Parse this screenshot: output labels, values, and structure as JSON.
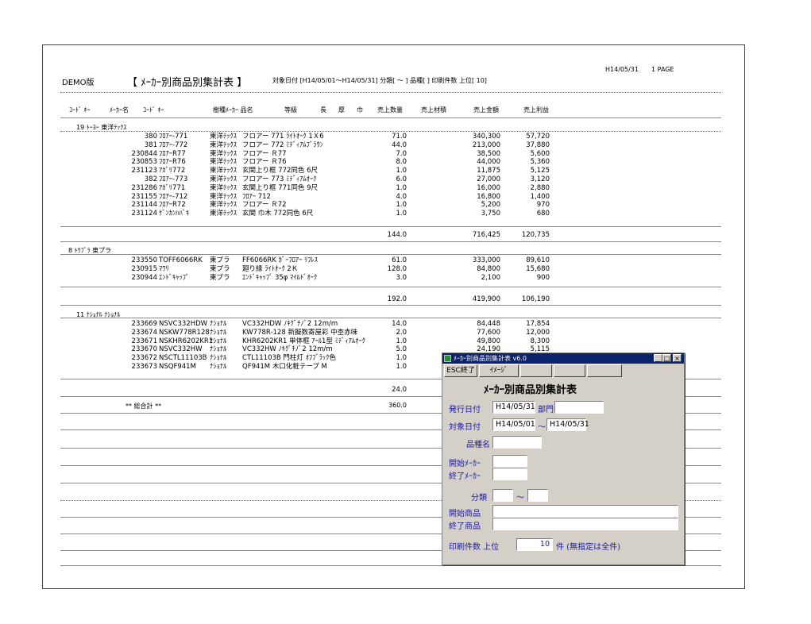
{
  "report": {
    "demo_label": "DEMO版",
    "title": "【 ﾒｰｶｰ別商品別集計表 】",
    "criteria": "対象日付 [H14/05/01～H14/05/31]  分類[   ～   ] 品種[              ]  印刷件数 上位[   10]",
    "print_date": "H14/05/31",
    "page": "1 PAGE"
  },
  "columns": {
    "c1": "ｺｰﾄﾞ ｷｰ",
    "c2": "ﾒｰｶｰ名",
    "c3": "ｺｰﾄﾞ ｷｰ",
    "c4": "樹種ﾒｰｶｰ 品名",
    "c5": "等級",
    "c6": "長",
    "c7": "厚",
    "c8": "巾",
    "c9": "売上数量",
    "c10": "売上材積",
    "c11": "売上金額",
    "c12": "売上利益"
  },
  "groups": [
    {
      "header": "19 ﾄｰﾖｰ   東洋ﾃｯｸｽ",
      "items": [
        {
          "code": "380",
          "name": "ﾌﾛｱｰ-771",
          "maker": "東洋ﾃｯｸｽ",
          "desc": "フロアー 771 ﾗｲﾄｵｰｸ 1Ｘ6",
          "qty": "71.0",
          "amount": "340,300",
          "profit": "57,720"
        },
        {
          "code": "381",
          "name": "ﾌﾛｱｰ-772",
          "maker": "東洋ﾃｯｸｽ",
          "desc": "フロアー 772 ﾐﾃﾞｨｱﾑﾌﾞﾗｳﾝ",
          "qty": "44.0",
          "amount": "213,000",
          "profit": "37,880"
        },
        {
          "code": "230844",
          "name": "ﾌﾛｱｰR77",
          "maker": "東洋ﾃｯｸｽ",
          "desc": "フロアー  Ｒ77",
          "qty": "7.0",
          "amount": "38,500",
          "profit": "5,600"
        },
        {
          "code": "230853",
          "name": "ﾌﾛｱｰR76",
          "maker": "東洋ﾃｯｸｽ",
          "desc": "フロアー  Ｒ76",
          "qty": "8.0",
          "amount": "44,000",
          "profit": "5,360"
        },
        {
          "code": "231123",
          "name": "ｱｶﾞﾘ772",
          "maker": "東洋ﾃｯｸｽ",
          "desc": "玄関上り框  772同色  6尺",
          "qty": "1.0",
          "amount": "11,875",
          "profit": "5,125"
        },
        {
          "code": "382",
          "name": "ﾌﾛｱｰ-773",
          "maker": "東洋ﾃｯｸｽ",
          "desc": "フロアー  773 ﾐﾃﾞｨｱﾑｵｰｸ",
          "qty": "6.0",
          "amount": "27,000",
          "profit": "3,120"
        },
        {
          "code": "231286",
          "name": "ｱｶﾞﾘ771",
          "maker": "東洋ﾃｯｸｽ",
          "desc": "玄関上り框  771同色  9尺",
          "qty": "1.0",
          "amount": "16,000",
          "profit": "2,880"
        },
        {
          "code": "231155",
          "name": "ﾌﾛｱｰ-712",
          "maker": "東洋ﾃｯｸｽ",
          "desc": "ﾌﾛｱｰ  712",
          "qty": "4.0",
          "amount": "16,800",
          "profit": "1,400"
        },
        {
          "code": "231144",
          "name": "ﾌﾛｱｰR72",
          "maker": "東洋ﾃｯｸｽ",
          "desc": "フロアー  Ｒ72",
          "qty": "1.0",
          "amount": "5,200",
          "profit": "970"
        },
        {
          "code": "231124",
          "name": "ｹﾞﾝｶﾝﾊﾊﾞｷ",
          "maker": "東洋ﾃｯｸｽ",
          "desc": "玄関 巾木 772同色 6尺",
          "qty": "1.0",
          "amount": "3,750",
          "profit": "680"
        }
      ],
      "subtotal": {
        "qty": "144.0",
        "amount": "716,425",
        "profit": "120,735"
      }
    },
    {
      "header": "8 ﾄｳﾌﾟﾗ  東プラ",
      "items": [
        {
          "code": "233550",
          "name": "TOFF6066RK",
          "maker": "東プラ",
          "desc": "FF6066RK ｶﾞｰﾌﾛｱｰ ﾘﾌﾚｽ",
          "qty": "61.0",
          "amount": "333,000",
          "profit": "89,610"
        },
        {
          "code": "230915",
          "name": "ﾏﾜﾘ",
          "maker": "東プラ",
          "desc": "廻り縁  ﾗｲﾄｵｰｸ   2Ｋ",
          "qty": "128.0",
          "amount": "84,800",
          "profit": "15,680"
        },
        {
          "code": "230944",
          "name": "ｴﾝﾄﾞｷｬｯﾌﾟ",
          "maker": "東プラ",
          "desc": "ｴﾝﾄﾞｷｬｯﾌﾟ 35φ ﾏｲﾙﾄﾞｵｰｸ",
          "qty": "3.0",
          "amount": "2,100",
          "profit": "900"
        }
      ],
      "subtotal": {
        "qty": "192.0",
        "amount": "419,900",
        "profit": "106,190"
      }
    },
    {
      "header": "11 ﾅｼｮﾅﾙ  ﾅｼｮﾅﾙ",
      "items": [
        {
          "code": "233669",
          "name": "NSVC332HDW",
          "maker": "ﾅｼｮﾅﾙ",
          "desc": "VC332HDW ﾉｷｸﾞﾁﾉﾞ2  12m/m",
          "qty": "14.0",
          "amount": "84,448",
          "profit": "17,854"
        },
        {
          "code": "233674",
          "name": "NSKW778R128",
          "maker": "ﾅｼｮﾅﾙ",
          "desc": "KW778R-128 新擬数寄屋彩 中杢赤味",
          "qty": "2.0",
          "amount": "77,600",
          "profit": "12,000"
        },
        {
          "code": "233671",
          "name": "NSKHR6202KR1",
          "maker": "ﾅｼｮﾅﾙ",
          "desc": "KHR6202KR1 単体框 ｱｰﾙ1型 ﾐﾃﾞｨｱﾑｵｰｸ",
          "qty": "1.0",
          "amount": "49,800",
          "profit": "8,300"
        },
        {
          "code": "233670",
          "name": "NSVC332HW",
          "maker": "ﾅｼｮﾅﾙ",
          "desc": "VC332HW ﾉｷｸﾞﾁﾉﾞ2  12m/m",
          "qty": "5.0",
          "amount": "24,190",
          "profit": "5,115"
        },
        {
          "code": "233672",
          "name": "NSCTL11103B",
          "maker": "ﾅｼｮﾅﾙ",
          "desc": "CTL11103B 門柱灯 ｵﾌﾌﾞﾗｯｸ色",
          "qty": "1.0",
          "amount": "",
          "profit": ""
        },
        {
          "code": "233673",
          "name": "NSQF941M",
          "maker": "ﾅｼｮﾅﾙ",
          "desc": "QF941M 木口化粧テープ M",
          "qty": "1.0",
          "amount": "",
          "profit": ""
        }
      ],
      "subtotal": {
        "qty": "24.0",
        "amount": "",
        "profit": ""
      }
    }
  ],
  "grand_total": {
    "label": "** 総合計 **",
    "qty": "360.0"
  },
  "dialog": {
    "title": "ﾒｰｶｰ別商品別集計表 v6.0",
    "win_min": "_",
    "win_max": "□",
    "win_close": "×",
    "btn_exit": "ESC終了",
    "btn_image": "ｲﾒｰｼﾞ",
    "heading": "ﾒｰｶｰ別商品別集計表",
    "issue_date_label": "発行日付",
    "issue_date": "H14/05/31",
    "dept_label": "部門",
    "dept_value": "",
    "target_date_label": "対象日付",
    "target_from": "H14/05/01",
    "tilde": "～",
    "target_to": "H14/05/31",
    "kind_label": "品種名",
    "kind_value": "",
    "start_maker_label": "開始ﾒｰｶｰ",
    "start_maker_value": "",
    "end_maker_label": "終了ﾒｰｶｰ",
    "end_maker_value": "",
    "class_label": "分類",
    "class_from": "",
    "class_to": "",
    "start_product_label": "開始商品",
    "start_product_value": "",
    "end_product_label": "終了商品",
    "end_product_value": "",
    "print_count_label": "印刷件数  上位",
    "print_count": "10",
    "print_count_suffix": "件 (無指定は全件)"
  }
}
